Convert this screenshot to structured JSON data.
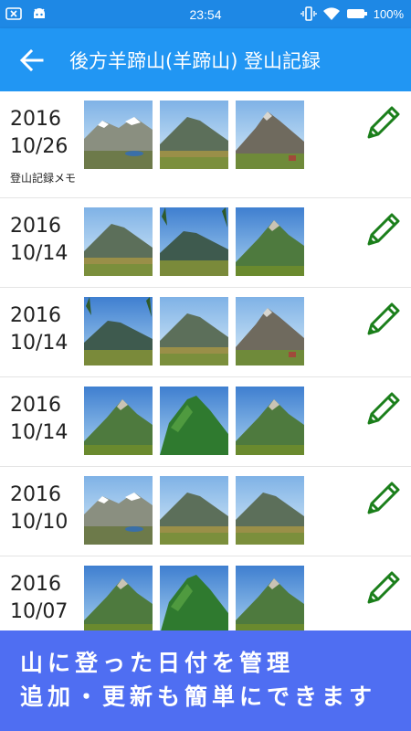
{
  "status_bar": {
    "time": "23:54",
    "battery": "100%",
    "icons": [
      "notification-x-icon",
      "android-icon",
      "vibrate-icon",
      "wifi-icon",
      "battery-icon"
    ]
  },
  "app_bar": {
    "title": "後方羊蹄山(羊蹄山) 登山記録",
    "back_icon": "arrow-left-icon"
  },
  "records": [
    {
      "year": "2016",
      "date": "10/26",
      "memo": "登山記録メモ",
      "photos": [
        "snow",
        "green",
        "rocky"
      ]
    },
    {
      "year": "2016",
      "date": "10/14",
      "memo": "",
      "photos": [
        "green",
        "blue",
        "alpine"
      ]
    },
    {
      "year": "2016",
      "date": "10/14",
      "memo": "",
      "photos": [
        "blue",
        "green",
        "rocky"
      ]
    },
    {
      "year": "2016",
      "date": "10/14",
      "memo": "",
      "photos": [
        "alpine",
        "forest",
        "alpine"
      ]
    },
    {
      "year": "2016",
      "date": "10/10",
      "memo": "",
      "photos": [
        "snow",
        "green",
        "green"
      ]
    },
    {
      "year": "2016",
      "date": "10/07",
      "memo": "",
      "photos": [
        "alpine",
        "forest",
        "alpine"
      ]
    }
  ],
  "banner": {
    "line1": "山に登った日付を管理",
    "line2": "追加・更新も簡単にできます"
  },
  "colors": {
    "status_bar": "#1e88e5",
    "app_bar": "#2196f3",
    "banner": "#4f6ef2",
    "edit_icon": "#1b7f1b"
  }
}
